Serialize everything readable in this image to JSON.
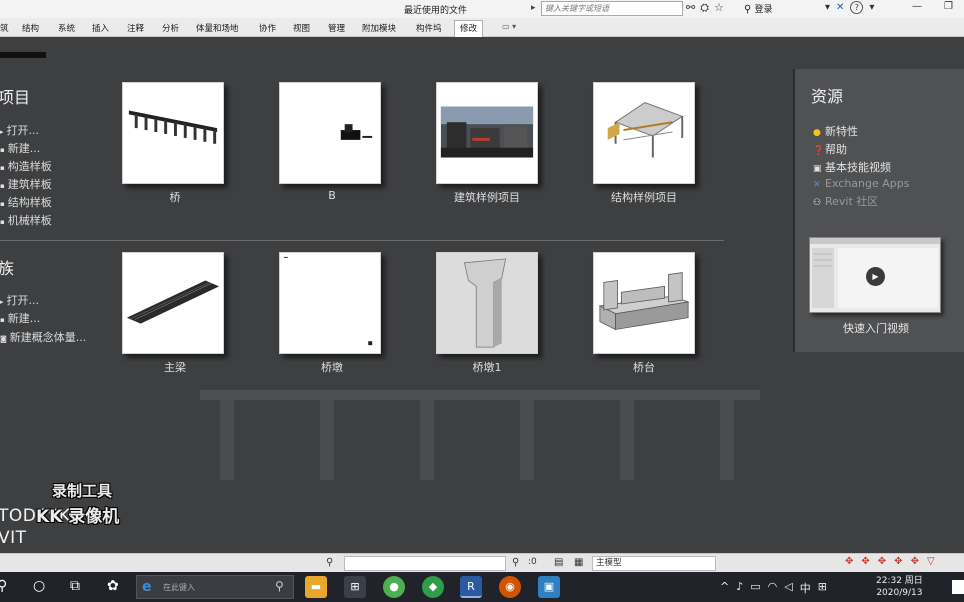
{
  "window": {
    "title": "最近使用的文件",
    "search_placeholder": "键入关键字或短语",
    "login_label": "登录",
    "help_symbol": "?"
  },
  "ribbon": {
    "tabs": [
      "筑",
      "结构",
      "系统",
      "插入",
      "注释",
      "分析",
      "体量和场地",
      "协作",
      "视图",
      "管理",
      "附加模块",
      "构件坞",
      "修改"
    ],
    "active_tab": "修改"
  },
  "projects": {
    "title": "项目",
    "links": [
      "打开...",
      "新建...",
      "构造样板",
      "建筑样板",
      "结构样板",
      "机械样板"
    ],
    "thumbnails": [
      {
        "label": "桥",
        "art": "bridge"
      },
      {
        "label": "B",
        "art": "b-model"
      },
      {
        "label": "建筑样例项目",
        "art": "arch-sample"
      },
      {
        "label": "结构样例项目",
        "art": "struct-sample"
      }
    ]
  },
  "families": {
    "title": "族",
    "links": [
      "打开...",
      "新建...",
      "新建概念体量..."
    ],
    "thumbnails": [
      {
        "label": "主梁",
        "art": "girder"
      },
      {
        "label": "桥墩",
        "art": "pier-blank"
      },
      {
        "label": "桥墩1",
        "art": "pier-column"
      },
      {
        "label": "桥台",
        "art": "abutment"
      }
    ]
  },
  "resources": {
    "title": "资源",
    "links": [
      {
        "label": "新特性",
        "icon": "star-dot-icon"
      },
      {
        "label": "帮助",
        "icon": "help-icon"
      },
      {
        "label": "基本技能视频",
        "icon": "video-icon"
      },
      {
        "label": "Exchange Apps",
        "icon": "exchange-icon"
      },
      {
        "label": "Revit 社区",
        "icon": "community-icon"
      }
    ],
    "video_label": "快速入门视频"
  },
  "branding": {
    "line1": "TODESK",
    "line2": "VIT"
  },
  "watermark": {
    "line1": "录制工具",
    "line2": "KK 录像机"
  },
  "statusbar": {
    "filter_count": ":0",
    "model_select": "主模型"
  },
  "taskbar": {
    "search_placeholder": "在此键入",
    "time": "22:32 周日",
    "date": "2020/9/13",
    "ime": "中"
  }
}
